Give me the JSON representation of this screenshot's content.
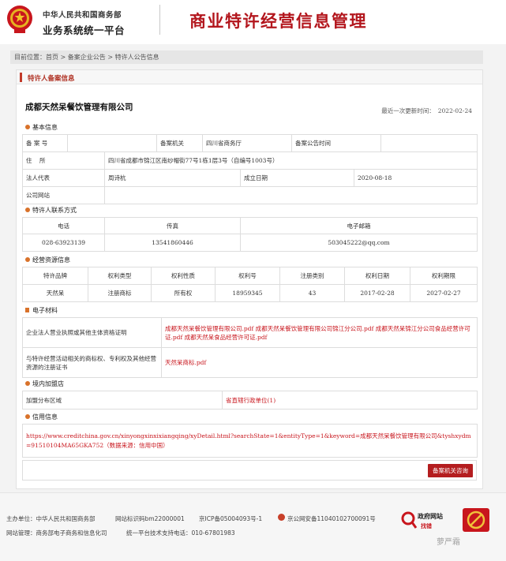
{
  "header": {
    "gov_name": "中华人民共和国商务部",
    "platform": "业务系统统一平台",
    "system_title": "商业特许经营信息管理"
  },
  "breadcrumb": {
    "label": "目前位置：",
    "items": [
      "首页",
      "备案企业公告",
      "特许人公告信息"
    ],
    "sep": " > "
  },
  "panel": {
    "title": "特许人备案信息"
  },
  "company": {
    "name": "成都天然呆餐饮管理有限公司",
    "updated_label": "最近一次更新时间：",
    "updated_value": "2022-02-24"
  },
  "basic": {
    "section": "基本信息",
    "filing_no_label": "备 案 号",
    "filing_no": "",
    "authority_label": "备案机关",
    "authority": "四川省商务厅",
    "announce_time_label": "备案公告时间",
    "announce_time": "",
    "address_label": "住    所",
    "address": "四川省成都市锦江区南纱帽街77号1栋1层3号（自编号1003号）",
    "legal_rep_label": "法人代表",
    "legal_rep": "周诗杭",
    "founded_label": "成立日期",
    "founded": "2020-08-18",
    "website_label": "公司网站",
    "website": ""
  },
  "contact": {
    "section": "特许人联系方式",
    "headers": [
      "电话",
      "传真",
      "电子邮箱"
    ],
    "values": [
      "028-63923139",
      "13541860446",
      "503045222@qq.com"
    ]
  },
  "resources": {
    "section": "经营资源信息",
    "headers": [
      "特许品牌",
      "权利类型",
      "权利性质",
      "权利号",
      "注册类别",
      "权利日期",
      "权利期限"
    ],
    "values": [
      "天然呆",
      "注册商标",
      "所有权",
      "18959345",
      "43",
      "2017-02-28",
      "2027-02-27"
    ]
  },
  "materials": {
    "section": "电子材料",
    "row1_label": "企业法人营业执照或其他主体资格证明",
    "row1_value": "成都天然呆餐饮管理有限公司.pdf 成都天然呆餐饮管理有限公司锦江分公司.pdf 成都天然呆锦江分公司食品经营许可证.pdf 成都天然呆食品经营许可证.pdf",
    "row2_label": "与特许经营活动相关的商标权、专利权及其他经营资源的注册证书",
    "row2_value": "天然呆商标.pdf"
  },
  "stores": {
    "section": "境内加盟店",
    "region_label": "加盟分布区域",
    "region_value": "省直辖行政单位(1)"
  },
  "credit": {
    "section": "信用信息",
    "url": "https://www.creditchina.gov.cn/xinyongxinxixiangqing/xyDetail.html?searchState=1&entityType=1&keyword=成都天然呆餐饮管理有限公司&tyshxydm=91510104MA65GKA752（数据来源：信用中国）"
  },
  "actions": {
    "query_button": "备案机关咨询"
  },
  "footer": {
    "sponsor": "主办单位：中华人民共和国商务部",
    "site_code": "网站标识码bm22000001",
    "icp": "京ICP备05004093号-1",
    "police": "京公网安备11040102700091号",
    "management": "网站管理：商务部电子商务和信息化司",
    "support": "统一平台技术支持电话：010-67801983",
    "gov_site": "政府网站",
    "gov_site_sub": "找错",
    "watermark": "萝严霜"
  }
}
